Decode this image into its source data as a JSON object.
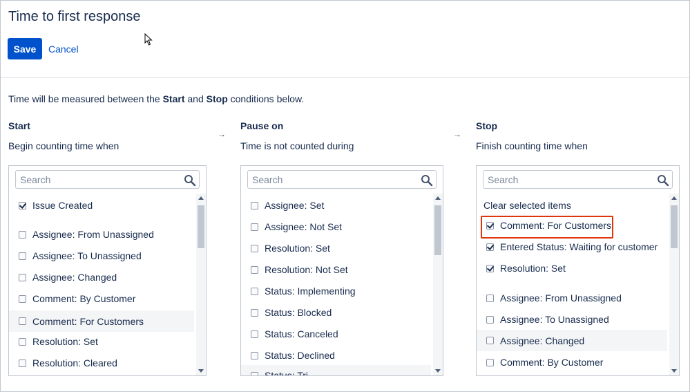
{
  "page": {
    "title": "Time to first response",
    "save_label": "Save",
    "cancel_label": "Cancel",
    "intro": {
      "before": "Time will be measured between the ",
      "start_word": "Start",
      "middle": " and ",
      "stop_word": "Stop",
      "after": " conditions below."
    },
    "arrow": "→"
  },
  "columns": {
    "start": {
      "heading": "Start",
      "subtitle": "Begin counting time when",
      "search_placeholder": "Search",
      "items": [
        {
          "label": "Issue Created",
          "checked": true
        },
        {
          "label": "Assignee: From Unassigned",
          "checked": false
        },
        {
          "label": "Assignee: To Unassigned",
          "checked": false
        },
        {
          "label": "Assignee: Changed",
          "checked": false
        },
        {
          "label": "Comment: By Customer",
          "checked": false
        },
        {
          "label": "Comment: For Customers",
          "checked": false
        },
        {
          "label": "Resolution: Set",
          "checked": false
        },
        {
          "label": "Resolution: Cleared",
          "checked": false
        }
      ]
    },
    "pause": {
      "heading": "Pause on",
      "subtitle": "Time is not counted during",
      "search_placeholder": "Search",
      "items": [
        {
          "label": "Assignee: Set",
          "checked": false
        },
        {
          "label": "Assignee: Not Set",
          "checked": false
        },
        {
          "label": "Resolution: Set",
          "checked": false
        },
        {
          "label": "Resolution: Not Set",
          "checked": false
        },
        {
          "label": "Status: Implementing",
          "checked": false
        },
        {
          "label": "Status: Blocked",
          "checked": false
        },
        {
          "label": "Status: Canceled",
          "checked": false
        },
        {
          "label": "Status: Declined",
          "checked": false
        },
        {
          "label": "Status: Tri...",
          "checked": false
        }
      ]
    },
    "stop": {
      "heading": "Stop",
      "subtitle": "Finish counting time when",
      "search_placeholder": "Search",
      "clear_label": "Clear selected items",
      "items": [
        {
          "label": "Comment: For Customers",
          "checked": true
        },
        {
          "label": "Entered Status: Waiting for customer",
          "checked": true
        },
        {
          "label": "Resolution: Set",
          "checked": true
        },
        {
          "label": "Assignee: From Unassigned",
          "checked": false
        },
        {
          "label": "Assignee: To Unassigned",
          "checked": false
        },
        {
          "label": "Assignee: Changed",
          "checked": false
        },
        {
          "label": "Comment: By Customer",
          "checked": false
        }
      ]
    }
  },
  "colors": {
    "primary": "#0052cc",
    "highlight_border": "#de350b",
    "text": "#172b4d",
    "row_highlight": "#f4f5f7"
  }
}
